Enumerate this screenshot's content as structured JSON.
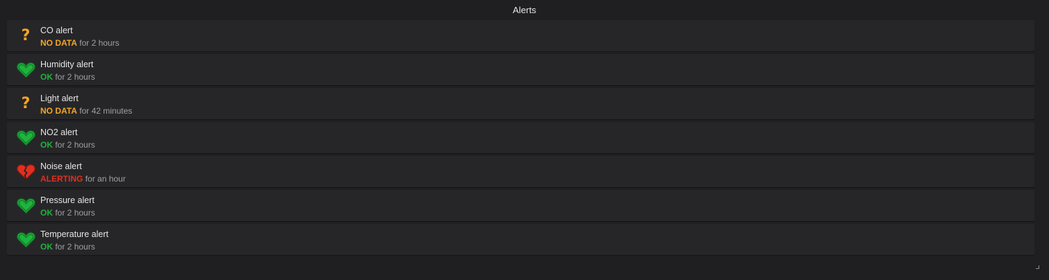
{
  "panel": {
    "title": "Alerts"
  },
  "colors": {
    "ok": "#1fb33d",
    "no_data": "#f5a623",
    "alerting": "#e02f20"
  },
  "alerts": [
    {
      "name": "CO alert",
      "state": "NO DATA",
      "state_class": "nodata",
      "icon": "question-mark-icon",
      "duration": "for 2 hours"
    },
    {
      "name": "Humidity alert",
      "state": "OK",
      "state_class": "ok",
      "icon": "heart-icon",
      "duration": "for 2 hours"
    },
    {
      "name": "Light alert",
      "state": "NO DATA",
      "state_class": "nodata",
      "icon": "question-mark-icon",
      "duration": "for 42 minutes"
    },
    {
      "name": "NO2 alert",
      "state": "OK",
      "state_class": "ok",
      "icon": "heart-icon",
      "duration": "for 2 hours"
    },
    {
      "name": "Noise alert",
      "state": "ALERTING",
      "state_class": "alerting",
      "icon": "broken-heart-icon",
      "duration": "for an hour"
    },
    {
      "name": "Pressure alert",
      "state": "OK",
      "state_class": "ok",
      "icon": "heart-icon",
      "duration": "for 2 hours"
    },
    {
      "name": "Temperature alert",
      "state": "OK",
      "state_class": "ok",
      "icon": "heart-icon",
      "duration": "for 2 hours"
    }
  ]
}
